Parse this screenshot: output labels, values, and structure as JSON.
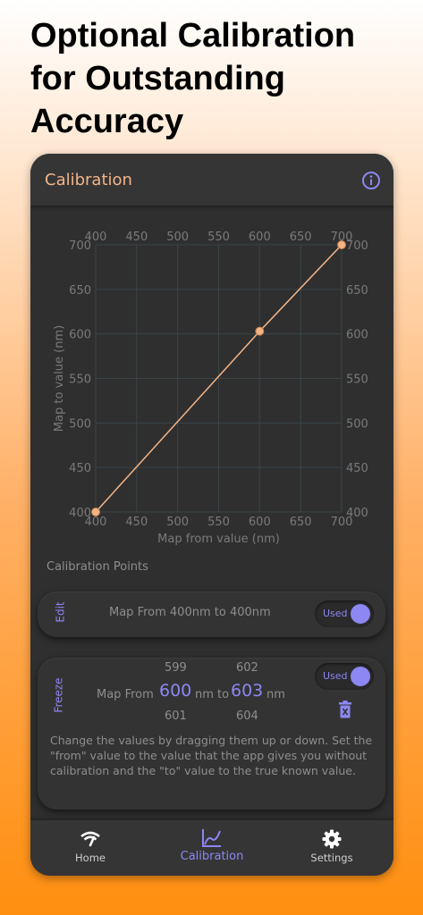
{
  "headline": "Optional Calibration for Outstanding Accuracy",
  "topbar": {
    "title": "Calibration",
    "info_icon": "info-icon"
  },
  "chart_data": {
    "type": "line",
    "xlabel": "Map from value (nm)",
    "ylabel": "Map to value (nm)",
    "xlim": [
      400,
      700
    ],
    "ylim": [
      400,
      700
    ],
    "xticks": [
      "400",
      "450",
      "500",
      "550",
      "600",
      "650",
      "700"
    ],
    "yticks": [
      "400",
      "450",
      "500",
      "550",
      "600",
      "650",
      "700"
    ],
    "grid": true,
    "series": [
      {
        "points": [
          [
            400,
            400
          ],
          [
            600,
            603
          ],
          [
            700,
            700
          ]
        ]
      }
    ],
    "colors": {
      "line": "#f3b487",
      "grid": "#3a4548",
      "tick": "#7a7a7a"
    }
  },
  "section_label": "Calibration Points",
  "point1": {
    "mode_label": "Edit",
    "text": "Map From 400nm to 400nm",
    "toggle_label": "Used"
  },
  "point2": {
    "mode_label": "Freeze",
    "map_from": "Map From",
    "from_above": "599",
    "from_value": "600",
    "from_below": "601",
    "to_word": "nm to",
    "to_above": "602",
    "to_value": "603",
    "to_below": "604",
    "unit": "nm",
    "toggle_label": "Used",
    "delete_icon": "delete-icon",
    "help": "Change the values by dragging them up or down. Set the \"from\" value to the value that the app gives you without calibration and the \"to\" value to the true known value."
  },
  "nav": {
    "items": [
      {
        "label": "Home",
        "icon": "home-signal-icon"
      },
      {
        "label": "Calibration",
        "icon": "chart-line-icon",
        "active": true
      },
      {
        "label": "Settings",
        "icon": "gear-icon"
      }
    ]
  },
  "colors": {
    "accent": "#8c87f2",
    "title": "#f3b487",
    "panel": "#2f2f30"
  }
}
